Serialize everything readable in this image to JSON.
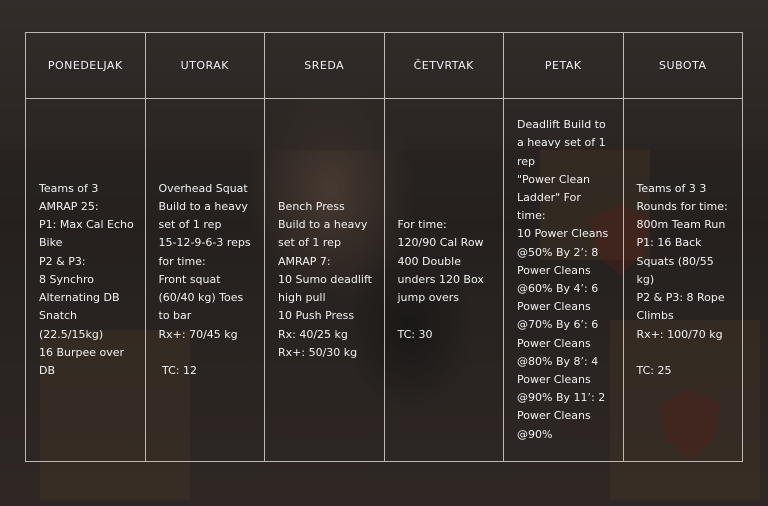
{
  "days": [
    {
      "name": "PONEDELJAK",
      "text": "Teams of 3\nAMRAP 25:\nP1: Max Cal Echo Bike\nP2 & P3:\n8 Synchro Alternating DB Snatch (22.5/15kg)\n16 Burpee over DB"
    },
    {
      "name": "UTORAK",
      "text": "Overhead Squat Build to a heavy set of 1 rep\n15-12-9-6-3 reps for time:\nFront squat (60/40 kg) Toes to bar\nRx+: 70/45 kg\n\n TC: 12"
    },
    {
      "name": "SREDA",
      "text": "Bench Press\nBuild to a heavy set of 1 rep\nAMRAP 7:\n10 Sumo deadlift high pull\n10 Push Press\nRx: 40/25 kg\nRx+: 50/30 kg"
    },
    {
      "name": "ČETVRTAK",
      "text": "For time:\n120/90 Cal Row\n400 Double unders 120 Box jump overs\n\nTC: 30"
    },
    {
      "name": "PETAK",
      "text": "Deadlift Build to a heavy set of 1 rep\n\"Power Clean Ladder\" For time:\n10 Power Cleans @50% By 2’: 8 Power Cleans @60% By 4’: 6 Power Cleans @70% By 6’: 6 Power Cleans @80% By 8’: 4 Power Cleans @90% By 11’: 2 Power Cleans @90%"
    },
    {
      "name": "SUBOTA",
      "text": "Teams of 3 3 Rounds for time:\n800m Team Run\nP1: 16 Back Squats (80/55 kg)\nP2 & P3: 8 Rope Climbs\nRx+: 100/70 kg\n\nTC: 25"
    }
  ]
}
